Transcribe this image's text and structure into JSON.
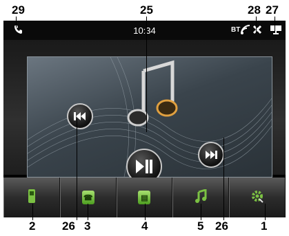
{
  "callouts": {
    "c29": "29",
    "c25": "25",
    "c28": "28",
    "c27": "27",
    "c2": "2",
    "c26a": "26",
    "c3": "3",
    "c4": "4",
    "c5": "5",
    "c26b": "26",
    "c1": "1"
  },
  "status_bar": {
    "time": "10:34",
    "bt_label": "BT",
    "phone_icon": "phone-icon",
    "settings_icon": "tools-icon",
    "display_icon": "monitor-icon"
  },
  "player": {
    "prev_icon": "previous-track-icon",
    "play_pause_icon": "play-pause-icon",
    "next_icon": "next-track-icon",
    "art_icon": "music-note-icon"
  },
  "dock": [
    {
      "icon": "mobile-phone-icon"
    },
    {
      "icon": "dialer-icon"
    },
    {
      "icon": "phonebook-icon"
    },
    {
      "icon": "music-icon"
    },
    {
      "icon": "settings-gear-icon"
    }
  ],
  "colors": {
    "accent_green": "#7bc143",
    "screen_bg": "#000000"
  }
}
